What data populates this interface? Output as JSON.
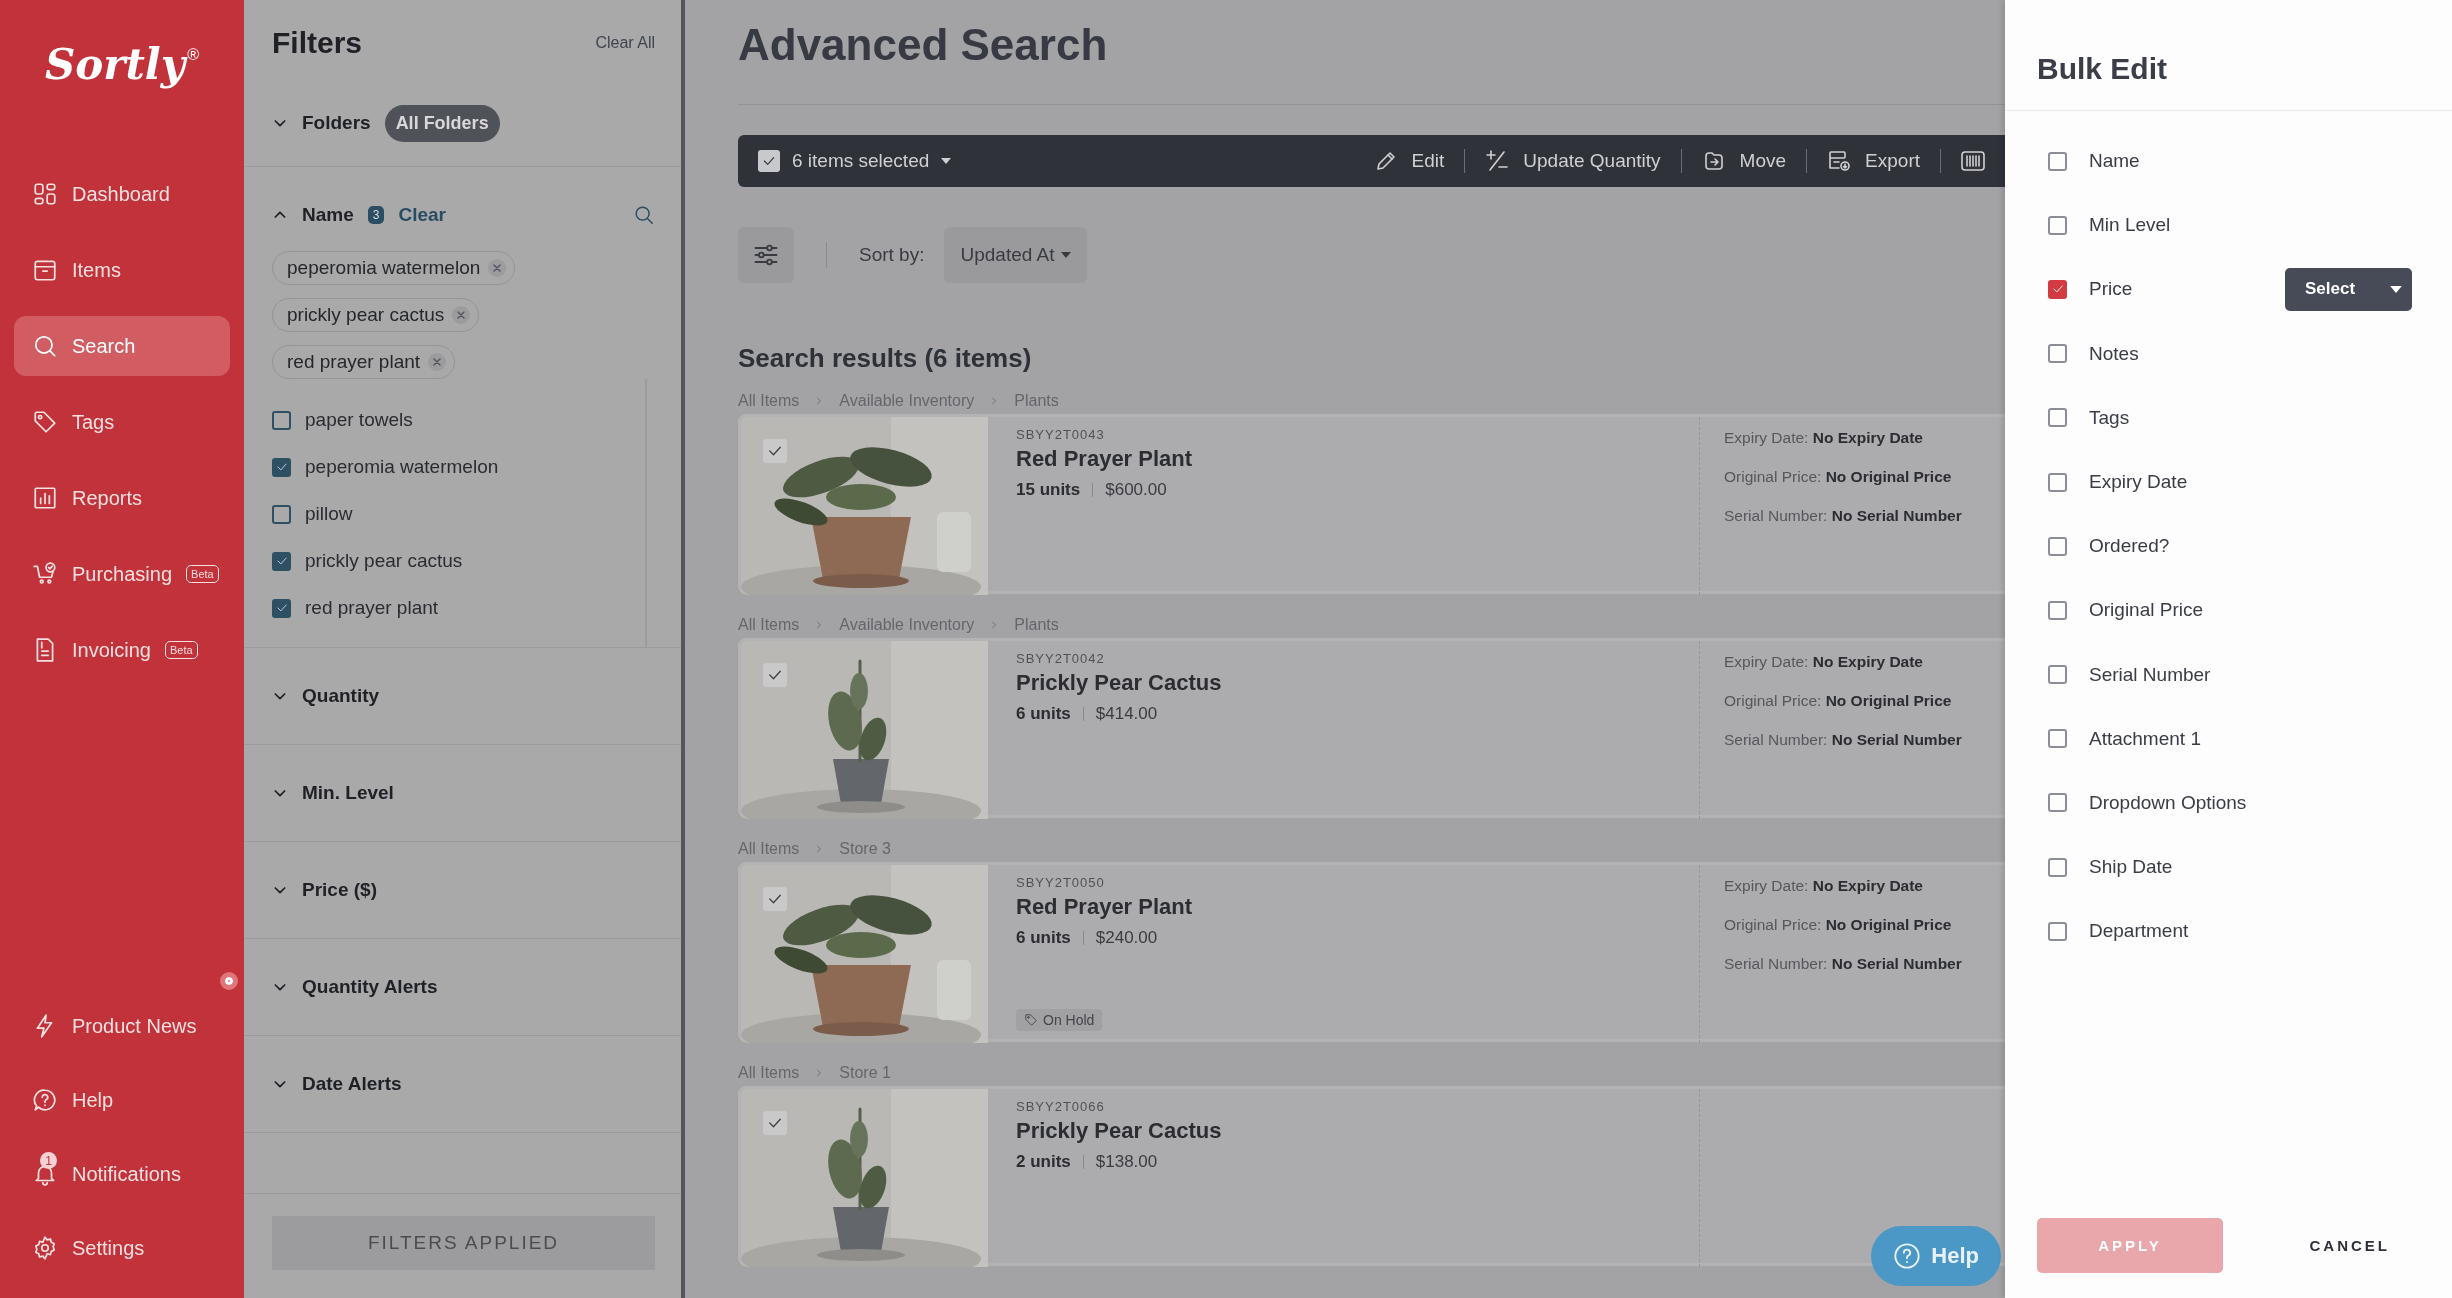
{
  "sidebar": {
    "logo": "Sortly",
    "logo_mark": "®",
    "nav": [
      {
        "label": "Dashboard",
        "selected": false
      },
      {
        "label": "Items",
        "selected": false
      },
      {
        "label": "Search",
        "selected": true
      },
      {
        "label": "Tags",
        "selected": false
      },
      {
        "label": "Reports",
        "selected": false
      },
      {
        "label": "Purchasing",
        "selected": false,
        "badge": "Beta"
      },
      {
        "label": "Invoicing",
        "selected": false,
        "badge": "Beta"
      }
    ],
    "bottom_nav": [
      {
        "label": "Product News",
        "new": true
      },
      {
        "label": "Help",
        "new": false
      },
      {
        "label": "Notifications",
        "new": false,
        "count": "1"
      },
      {
        "label": "Settings",
        "new": false
      }
    ]
  },
  "filters": {
    "title": "Filters",
    "clear_all": "Clear All",
    "sections": [
      {
        "kind": "folders",
        "label": "Folders",
        "expanded": false,
        "chip": "All Folders"
      },
      {
        "kind": "name",
        "label": "Name",
        "expanded": true,
        "count": "3",
        "clear": "Clear",
        "chips": [
          "peperomia watermelon",
          "prickly pear cactus",
          "red prayer plant"
        ],
        "options": [
          {
            "label": "paper towels",
            "checked": false
          },
          {
            "label": "peperomia watermelon",
            "checked": true
          },
          {
            "label": "pillow",
            "checked": false
          },
          {
            "label": "prickly pear cactus",
            "checked": true
          },
          {
            "label": "red prayer plant",
            "checked": true
          }
        ]
      },
      {
        "kind": "plain",
        "label": "Quantity",
        "expanded": false
      },
      {
        "kind": "plain",
        "label": "Min. Level",
        "expanded": false
      },
      {
        "kind": "plain",
        "label": "Price ($)",
        "expanded": false
      },
      {
        "kind": "plain",
        "label": "Quantity Alerts",
        "expanded": false
      },
      {
        "kind": "plain",
        "label": "Date Alerts",
        "expanded": false
      }
    ],
    "applied_button": "FILTERS APPLIED"
  },
  "main": {
    "title": "Advanced Search",
    "toolbar": {
      "selection": "6 items selected",
      "checked": true,
      "actions": [
        "Edit",
        "Update Quantity",
        "Move",
        "Export"
      ]
    },
    "sort": {
      "label": "Sort by:",
      "value": "Updated At"
    },
    "results_heading": "Search results (6 items)",
    "results": [
      {
        "breadcrumb": [
          "All Items",
          "Available Inventory",
          "Plants"
        ],
        "checked": true,
        "code": "SBYY2T0043",
        "name": "Red Prayer Plant",
        "units": "15 units",
        "price": "$600.00",
        "details": [
          {
            "label": "Expiry Date:",
            "value": "No Expiry Date"
          },
          {
            "label": "Original Price:",
            "value": "No Original Price"
          },
          {
            "label": "Serial Number:",
            "value": "No Serial Number"
          }
        ]
      },
      {
        "breadcrumb": [
          "All Items",
          "Available Inventory",
          "Plants"
        ],
        "checked": true,
        "code": "SBYY2T0042",
        "name": "Prickly Pear Cactus",
        "units": "6 units",
        "price": "$414.00",
        "details": [
          {
            "label": "Expiry Date:",
            "value": "No Expiry Date"
          },
          {
            "label": "Original Price:",
            "value": "No Original Price"
          },
          {
            "label": "Serial Number:",
            "value": "No Serial Number"
          }
        ]
      },
      {
        "breadcrumb": [
          "All Items",
          "Store 3"
        ],
        "checked": true,
        "code": "SBYY2T0050",
        "name": "Red Prayer Plant",
        "units": "6 units",
        "price": "$240.00",
        "tag": "On Hold",
        "details": [
          {
            "label": "Expiry Date:",
            "value": "No Expiry Date"
          },
          {
            "label": "Original Price:",
            "value": "No Original Price"
          },
          {
            "label": "Serial Number:",
            "value": "No Serial Number"
          }
        ]
      },
      {
        "breadcrumb": [
          "All Items",
          "Store 1"
        ],
        "checked": true,
        "code": "SBYY2T0066",
        "name": "Prickly Pear Cactus",
        "units": "2 units",
        "price": "$138.00"
      }
    ],
    "help_button": "Help"
  },
  "bulk_edit": {
    "title": "Bulk Edit",
    "fields": [
      {
        "label": "Name",
        "checked": false
      },
      {
        "label": "Min Level",
        "checked": false
      },
      {
        "label": "Price",
        "checked": true,
        "action": "Select"
      },
      {
        "label": "Notes",
        "checked": false
      },
      {
        "label": "Tags",
        "checked": false
      },
      {
        "label": "Expiry Date",
        "checked": false
      },
      {
        "label": "Ordered?",
        "checked": false
      },
      {
        "label": "Original Price",
        "checked": false
      },
      {
        "label": "Serial Number",
        "checked": false
      },
      {
        "label": "Attachment 1",
        "checked": false
      },
      {
        "label": "Dropdown Options",
        "checked": false
      },
      {
        "label": "Ship Date",
        "checked": false
      },
      {
        "label": "Department",
        "checked": false
      }
    ],
    "apply": {
      "label": "APPLY",
      "disabled": true
    },
    "cancel": "CANCEL"
  }
}
